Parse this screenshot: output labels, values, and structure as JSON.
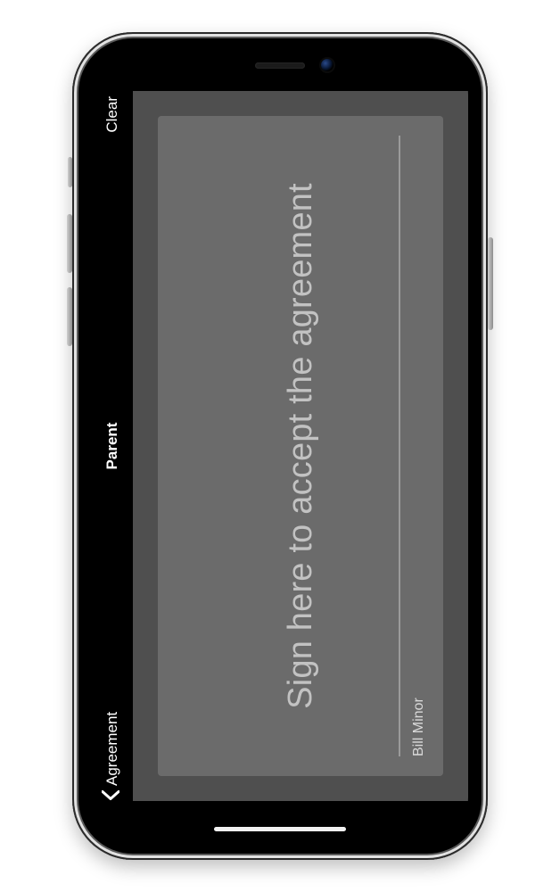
{
  "nav": {
    "back_label": "Agreement",
    "title": "Parent",
    "clear_label": "Clear"
  },
  "signature": {
    "placeholder": "Sign here to accept the agreement",
    "signer_name": "Bill Minor"
  },
  "colors": {
    "screen_bg": "#000000",
    "panel_bg": "#4f4f4f",
    "pad_bg": "#6b6b6b",
    "placeholder_text": "#c2c2c2"
  }
}
